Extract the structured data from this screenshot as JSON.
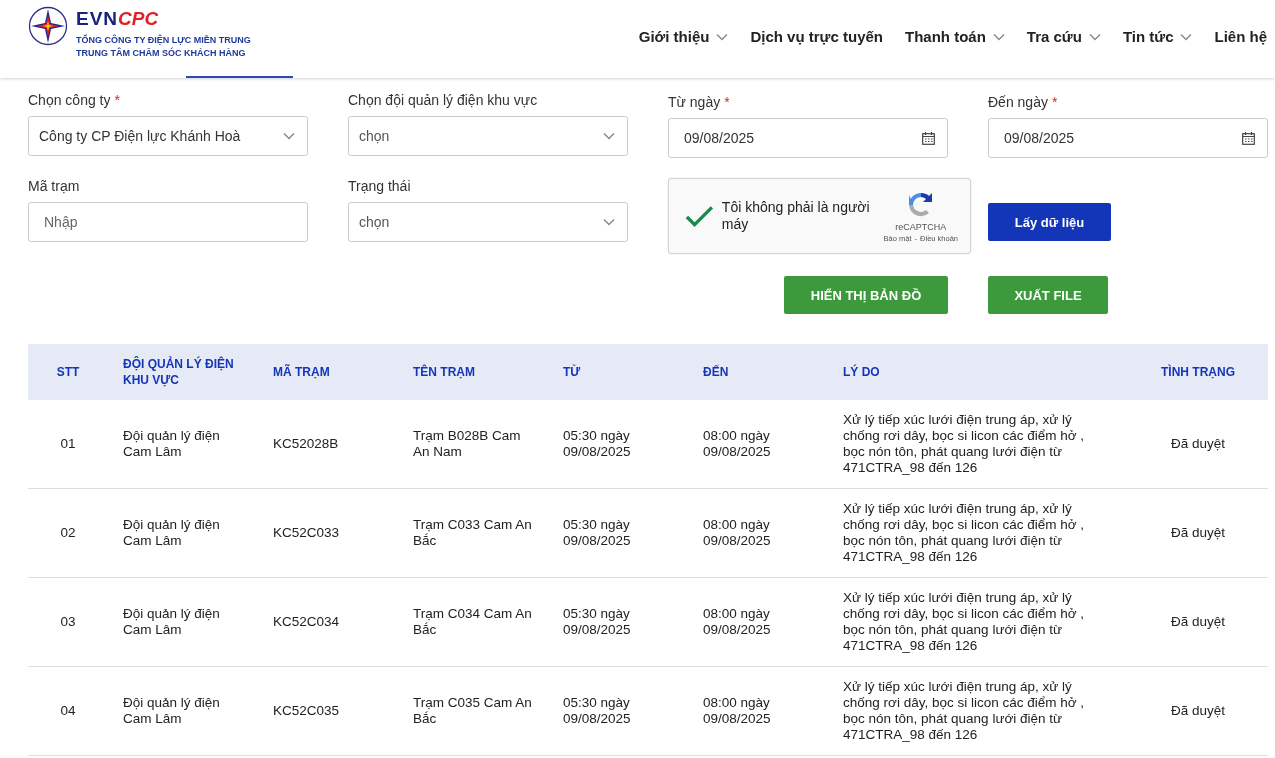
{
  "header": {
    "logo": {
      "brand_main": "EVN",
      "brand_accent": "CPC",
      "line_1": "TỔNG CÔNG TY ĐIỆN LỰC MIỀN TRUNG",
      "line_2": "TRUNG TÂM CHĂM SÓC KHÁCH HÀNG"
    },
    "nav": [
      {
        "label": "Giới thiệu",
        "has_dropdown": true
      },
      {
        "label": "Dịch vụ trực tuyến",
        "has_dropdown": false
      },
      {
        "label": "Thanh toán",
        "has_dropdown": true
      },
      {
        "label": "Tra cứu",
        "has_dropdown": true
      },
      {
        "label": "Tin tức",
        "has_dropdown": true
      },
      {
        "label": "Liên hệ",
        "has_dropdown": false
      }
    ]
  },
  "filters": {
    "columns": [
      {
        "fields": [
          {
            "kind": "select",
            "label": "Chọn công ty",
            "required_mark": "*",
            "value": "Công ty CP Điện lực Khánh Hoà"
          },
          {
            "kind": "text",
            "label": "Mã trạm",
            "placeholder": "Nhập"
          }
        ]
      },
      {
        "fields": [
          {
            "kind": "select",
            "label": "Chọn đội quản lý điện khu vực",
            "placeholder": "chọn"
          },
          {
            "kind": "select",
            "label": "Trạng thái",
            "placeholder": "chọn"
          }
        ]
      },
      {
        "fields": [
          {
            "kind": "date",
            "label": "Từ ngày",
            "required_mark": "*",
            "value": "09/08/2025"
          }
        ],
        "captcha": {
          "checked": true,
          "label": "Tôi không phải là người máy",
          "brand": "reCAPTCHA",
          "privacy": "Bảo mật",
          "separator": "-",
          "terms": "Điều khoản"
        },
        "button": {
          "label": "HIỂN THỊ BẢN ĐỒ",
          "kind": "map"
        }
      },
      {
        "fields": [
          {
            "kind": "date",
            "label": "Đến ngày",
            "required_mark": "*",
            "value": "09/08/2025"
          }
        ],
        "buttons": [
          {
            "label": "Lấy dữ liệu",
            "kind": "fetch"
          },
          {
            "label": "XUẤT FILE",
            "kind": "export"
          }
        ]
      }
    ]
  },
  "table": {
    "columns": [
      "STT",
      "ĐỘI QUẢN LÝ ĐIỆN KHU VỰC",
      "MÃ TRẠM",
      "TÊN TRẠM",
      "TỪ",
      "ĐẾN",
      "LÝ DO",
      "TÌNH TRẠNG"
    ],
    "rows": [
      [
        "01",
        "Đội quản lý điện Cam Lâm",
        "KC52028B",
        "Trạm B028B Cam An Nam",
        "05:30 ngày 09/08/2025",
        "08:00 ngày 09/08/2025",
        "Xử lý tiếp xúc lưới điện trung áp, xử lý chống rơi dây, bọc si licon các điểm hở , bọc nón tôn, phát quang lưới điện từ 471CTRA_98 đến 126",
        "Đã duyệt"
      ],
      [
        "02",
        "Đội quản lý điện Cam Lâm",
        "KC52C033",
        "Trạm C033 Cam An Bắc",
        "05:30 ngày 09/08/2025",
        "08:00 ngày 09/08/2025",
        "Xử lý tiếp xúc lưới điện trung áp, xử lý chống rơi dây, bọc si licon các điểm hở , bọc nón tôn, phát quang lưới điện từ 471CTRA_98 đến 126",
        "Đã duyệt"
      ],
      [
        "03",
        "Đội quản lý điện Cam Lâm",
        "KC52C034",
        "Trạm C034 Cam An Bắc",
        "05:30 ngày 09/08/2025",
        "08:00 ngày 09/08/2025",
        "Xử lý tiếp xúc lưới điện trung áp, xử lý chống rơi dây, bọc si licon các điểm hở , bọc nón tôn, phát quang lưới điện từ 471CTRA_98 đến 126",
        "Đã duyệt"
      ],
      [
        "04",
        "Đội quản lý điện Cam Lâm",
        "KC52C035",
        "Trạm C035 Cam An Bắc",
        "05:30 ngày 09/08/2025",
        "08:00 ngày 09/08/2025",
        "Xử lý tiếp xúc lưới điện trung áp, xử lý chống rơi dây, bọc si licon các điểm hở , bọc nón tôn, phát quang lưới điện từ 471CTRA_98 đến 126",
        "Đã duyệt"
      ]
    ]
  }
}
